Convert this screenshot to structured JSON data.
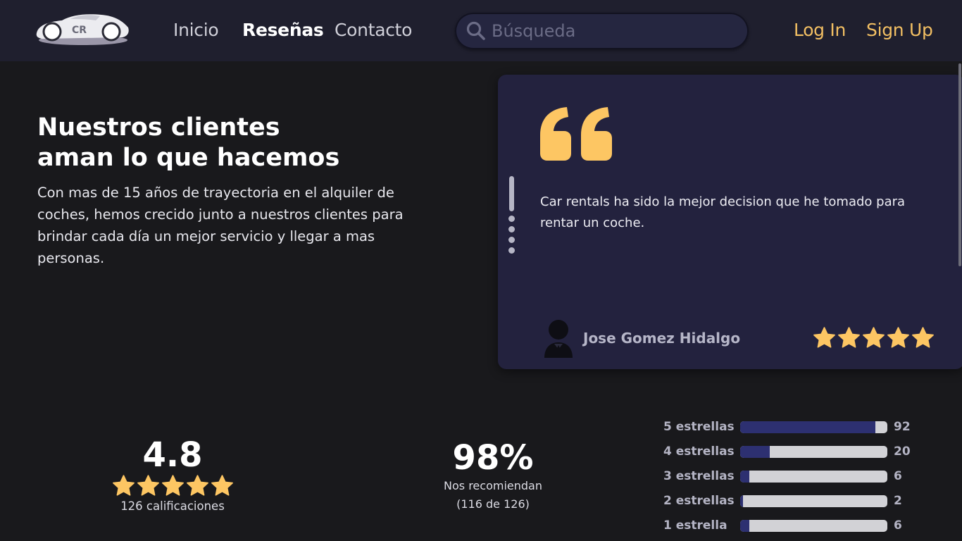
{
  "nav": {
    "logo_text": "CR",
    "links": [
      {
        "label": "Inicio",
        "active": false
      },
      {
        "label": "Reseñas",
        "active": true
      },
      {
        "label": "Contacto",
        "active": false
      }
    ],
    "search_placeholder": "Búsqueda",
    "login_label": "Log In",
    "signup_label": "Sign Up"
  },
  "hero": {
    "title_line1": "Nuestros clientes",
    "title_line2": "aman lo que hacemos",
    "text": "Con mas de 15 años de trayectoria en el alquiler de coches, hemos crecido junto a nuestros clientes para brindar cada día un mejor servicio y llegar a mas personas."
  },
  "review": {
    "text": "Car rentals ha sido la mejor decision que he tomado para rentar un coche.",
    "reviewer": "Jose Gomez Hidalgo",
    "stars": 5,
    "slide_count": 5,
    "active_slide": 0
  },
  "stats": {
    "rating": "4.8",
    "rating_stars": 5,
    "rating_count": "126 calificaciones",
    "recommend_pct": "98%",
    "recommend_label": "Nos recomiendan",
    "recommend_detail": "(116 de 126)",
    "distribution": [
      {
        "label": "5 estrellas",
        "count": "92",
        "fraction": 0.92
      },
      {
        "label": "4 estrellas",
        "count": "20",
        "fraction": 0.2
      },
      {
        "label": "3 estrellas",
        "count": "6",
        "fraction": 0.06
      },
      {
        "label": "2 estrellas",
        "count": "2",
        "fraction": 0.02
      },
      {
        "label": "1 estrella",
        "count": "6",
        "fraction": 0.06
      }
    ]
  },
  "colors": {
    "accent": "#f2bf63",
    "star": "#fdc663",
    "bar_fill": "#2d3071",
    "card_bg": "#23223e"
  }
}
